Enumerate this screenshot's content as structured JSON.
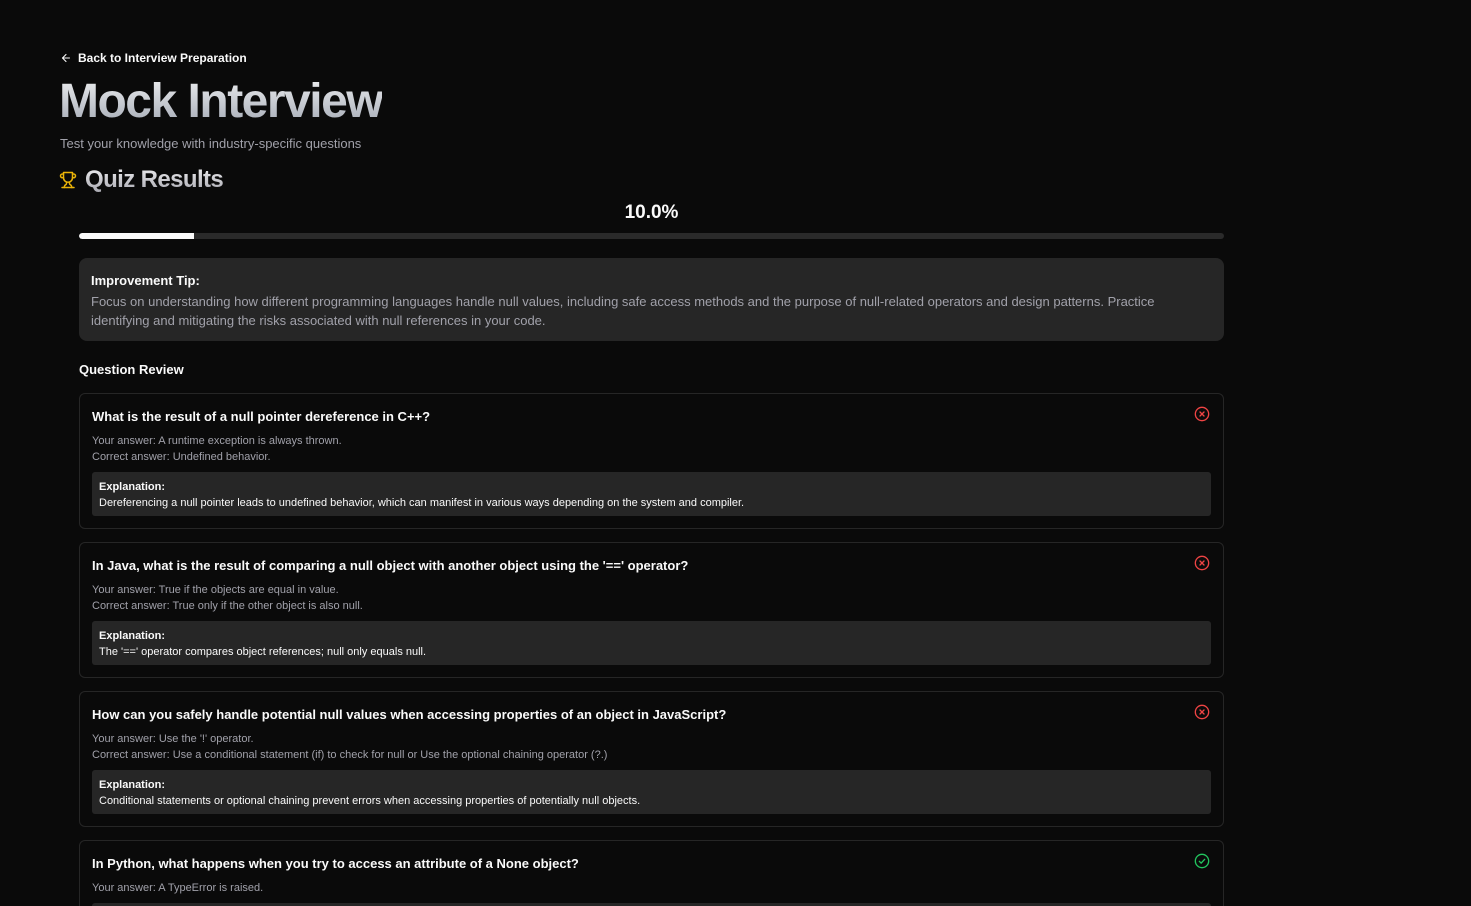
{
  "nav": {
    "back_label": "Back to Interview Preparation"
  },
  "header": {
    "title": "Mock Interview",
    "subtitle": "Test your knowledge with industry-specific questions"
  },
  "results": {
    "heading": "Quiz Results",
    "score_text": "10.0%",
    "score_fraction": 0.1
  },
  "tip": {
    "title": "Improvement Tip:",
    "body": "Focus on understanding how different programming languages handle null values, including safe access methods and the purpose of null-related operators and design patterns. Practice identifying and mitigating the risks associated with null references in your code."
  },
  "review": {
    "title": "Question Review",
    "questions": [
      {
        "question": "What is the result of a null pointer dereference in C++?",
        "status": "incorrect",
        "status_icon": "x-circle-icon",
        "your_answer": "Your answer: A runtime exception is always thrown.",
        "correct_answer": "Correct answer: Undefined behavior.",
        "explanation_title": "Explanation:",
        "explanation": "Dereferencing a null pointer leads to undefined behavior, which can manifest in various ways depending on the system and compiler."
      },
      {
        "question": "In Java, what is the result of comparing a null object with another object using the '==' operator?",
        "status": "incorrect",
        "status_icon": "x-circle-icon",
        "your_answer": "Your answer: True if the objects are equal in value.",
        "correct_answer": "Correct answer: True only if the other object is also null.",
        "explanation_title": "Explanation:",
        "explanation": "The '==' operator compares object references; null only equals null."
      },
      {
        "question": "How can you safely handle potential null values when accessing properties of an object in JavaScript?",
        "status": "incorrect",
        "status_icon": "x-circle-icon",
        "your_answer": "Your answer: Use the '!' operator.",
        "correct_answer": "Correct answer: Use a conditional statement (if) to check for null or Use the optional chaining operator (?.)",
        "explanation_title": "Explanation:",
        "explanation": "Conditional statements or optional chaining prevent errors when accessing properties of potentially null objects."
      },
      {
        "question": "In Python, what happens when you try to access an attribute of a None object?",
        "status": "correct",
        "status_icon": "check-circle-icon",
        "your_answer": "Your answer: A TypeError is raised."
      }
    ]
  },
  "colors": {
    "background": "#0a0a0a",
    "card": "#262626",
    "incorrect": "#ef4444",
    "correct": "#22c55e",
    "trophy": "#eab308"
  }
}
